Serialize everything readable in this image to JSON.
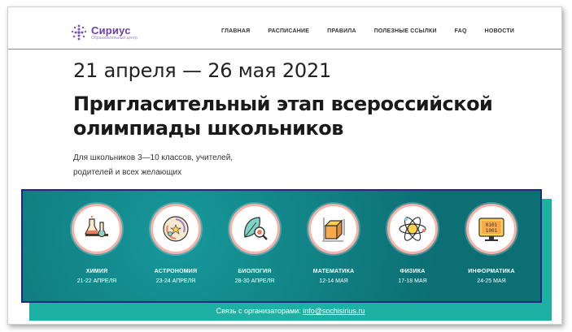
{
  "header": {
    "logo_name": "Сириус",
    "logo_sub": "Образовательный центр",
    "nav": [
      "ГЛАВНАЯ",
      "РАСПИСАНИЕ",
      "ПРАВИЛА",
      "ПОЛЕЗНЫЕ ССЫЛКИ",
      "FAQ",
      "НОВОСТИ"
    ]
  },
  "hero": {
    "date": "21 апреля — 26 мая 2021",
    "title_line1": "Пригласительный этап всероссийской",
    "title_line2": "олимпиады школьников",
    "subtitle_line1": "Для школьников 3—10 классов, учителей,",
    "subtitle_line2": "родителей и всех желающих"
  },
  "subjects": [
    {
      "name": "ХИМИЯ",
      "dates": "21-22 АПРЕЛЯ",
      "icon": "chemistry-flasks-icon"
    },
    {
      "name": "АСТРОНОМИЯ",
      "dates": "23-24 АПРЕЛЯ",
      "icon": "astronomy-galaxy-icon"
    },
    {
      "name": "БИОЛОГИЯ",
      "dates": "28-30 АПРЕЛЯ",
      "icon": "biology-leaf-icon"
    },
    {
      "name": "МАТЕМАТИКА",
      "dates": "12-14 МАЯ",
      "icon": "math-cube-icon"
    },
    {
      "name": "ФИЗИКА",
      "dates": "17-18 МАЯ",
      "icon": "physics-atom-icon"
    },
    {
      "name": "ИНФОРМАТИКА",
      "dates": "24-25 МАЯ",
      "icon": "informatics-binary-monitor-icon"
    }
  ],
  "footer": {
    "contact_label": "Связь с организаторами: ",
    "contact_email": "info@sochisirius.ru"
  },
  "colors": {
    "brand": "#6d3fa6",
    "panel": "#0e7e82",
    "panel_shadow": "#1fb0a4",
    "circle_ring": "#f7b1a6"
  }
}
